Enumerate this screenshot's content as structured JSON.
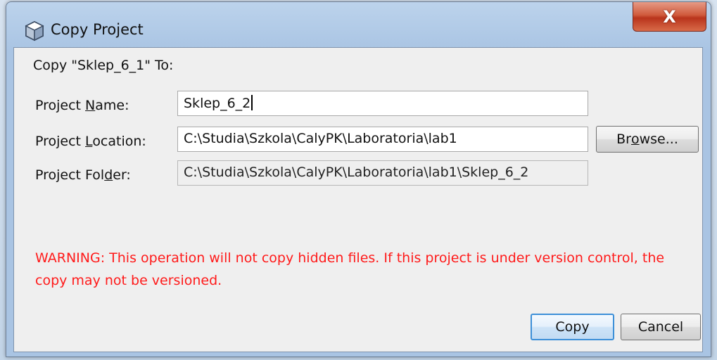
{
  "dialog": {
    "title": "Copy Project",
    "close_glyph": "X",
    "icon": "cube-icon"
  },
  "form": {
    "heading": "Copy \"Sklep_6_1\" To:",
    "project_name": {
      "label_pre": "Project ",
      "label_mnemonic": "N",
      "label_post": "ame:",
      "value": "Sklep_6_2"
    },
    "project_location": {
      "label_pre": "Project ",
      "label_mnemonic": "L",
      "label_post": "ocation:",
      "value": "C:\\Studia\\Szkola\\CalyPK\\Laboratoria\\lab1"
    },
    "project_folder": {
      "label_pre": "Project Fol",
      "label_mnemonic": "d",
      "label_post": "er:",
      "value": "C:\\Studia\\Szkola\\CalyPK\\Laboratoria\\lab1\\Sklep_6_2"
    },
    "browse": {
      "pre": "Br",
      "mnemonic": "o",
      "post": "wse..."
    }
  },
  "warning": "WARNING: This operation will not copy hidden files. If this project is under version control, the copy may not be versioned.",
  "buttons": {
    "copy": "Copy",
    "cancel": "Cancel"
  },
  "colors": {
    "warning": "#ff1a1a",
    "default_button_border": "#3c8fd8"
  }
}
